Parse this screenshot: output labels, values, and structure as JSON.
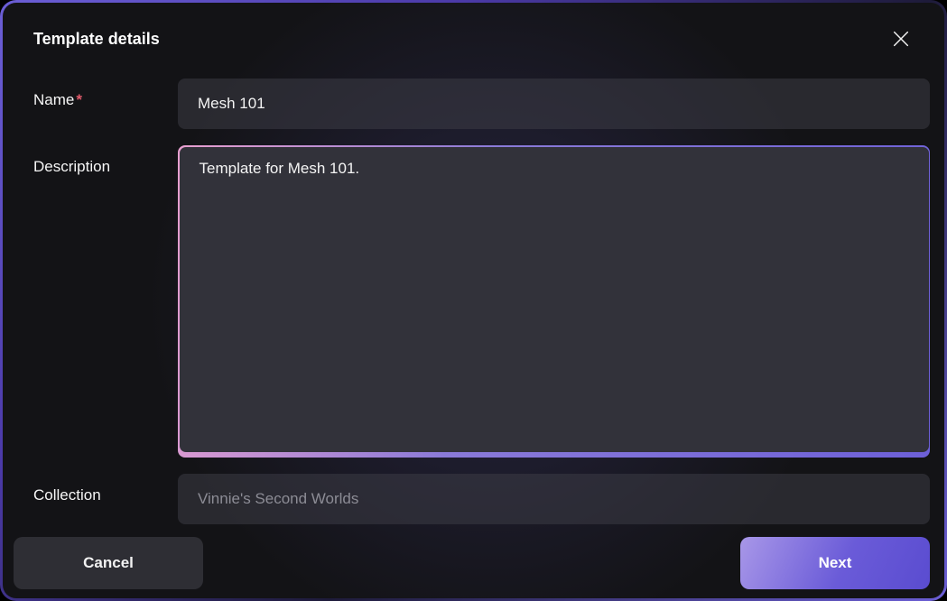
{
  "modal": {
    "title": "Template details"
  },
  "form": {
    "name_label": "Name",
    "name_required_mark": "*",
    "name_value": "Mesh 101",
    "description_label": "Description",
    "description_value": "Template for Mesh 101.",
    "collection_label": "Collection",
    "collection_placeholder": "Vinnie's Second Worlds"
  },
  "actions": {
    "cancel": "Cancel",
    "next": "Next"
  }
}
